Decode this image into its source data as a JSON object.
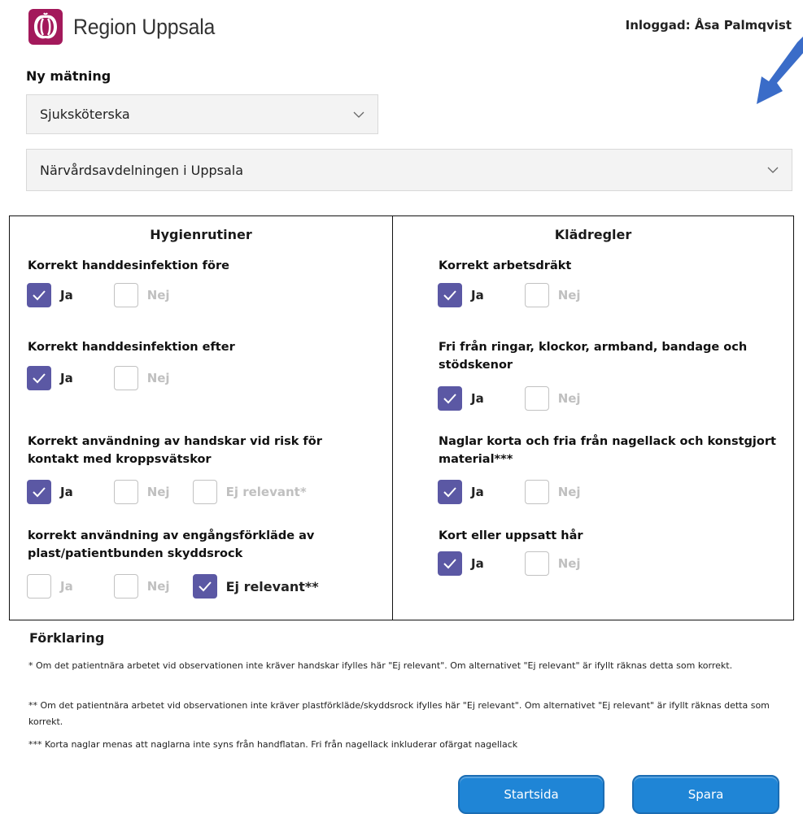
{
  "header": {
    "logo_text": "Region Uppsala",
    "user_label": "Inloggad: Åsa Palmqvist"
  },
  "form": {
    "title": "Ny mätning",
    "role_select": {
      "value": "Sjuksköterska"
    },
    "department_select": {
      "value": "Närvårdsavdelningen i Uppsala"
    }
  },
  "hygiene": {
    "title": "Hygienrutiner",
    "questions": [
      {
        "text": "Korrekt handdesinfektion före",
        "options": [
          {
            "label": "Ja",
            "checked": true
          },
          {
            "label": "Nej",
            "checked": false
          }
        ]
      },
      {
        "text": "Korrekt handdesinfektion efter",
        "options": [
          {
            "label": "Ja",
            "checked": true
          },
          {
            "label": "Nej",
            "checked": false
          }
        ]
      },
      {
        "text": "Korrekt användning av handskar vid risk för kontakt med kroppsvätskor",
        "options": [
          {
            "label": "Ja",
            "checked": true
          },
          {
            "label": "Nej",
            "checked": false
          },
          {
            "label": "Ej relevant*",
            "checked": false
          }
        ]
      },
      {
        "text": "korrekt användning av engångsförkläde av plast/patientbunden skyddsrock",
        "options": [
          {
            "label": "Ja",
            "checked": false
          },
          {
            "label": "Nej",
            "checked": false
          },
          {
            "label": "Ej relevant**",
            "checked": true
          }
        ]
      }
    ]
  },
  "clothing": {
    "title": "Klädregler",
    "questions": [
      {
        "text": "Korrekt arbetsdräkt",
        "options": [
          {
            "label": "Ja",
            "checked": true
          },
          {
            "label": "Nej",
            "checked": false
          }
        ]
      },
      {
        "text": "Fri från ringar, klockor, armband, bandage och stödskenor",
        "options": [
          {
            "label": "Ja",
            "checked": true
          },
          {
            "label": "Nej",
            "checked": false
          }
        ]
      },
      {
        "text": "Naglar korta och fria från nagellack och konstgjort material***",
        "options": [
          {
            "label": "Ja",
            "checked": true
          },
          {
            "label": "Nej",
            "checked": false
          }
        ]
      },
      {
        "text": "Kort eller uppsatt hår",
        "options": [
          {
            "label": "Ja",
            "checked": true
          },
          {
            "label": "Nej",
            "checked": false
          }
        ]
      }
    ]
  },
  "explanation": {
    "title": "Förklaring",
    "notes": [
      " * Om det patientnära arbetet vid observationen inte kräver handskar ifylles här \"Ej relevant\". Om alternativet \"Ej relevant\" är ifyllt räknas detta som korrekt.",
      " ** Om det patientnära arbetet vid observationen inte kräver plastförkläde/skyddsrock ifylles här \"Ej relevant\". Om alternativet \"Ej relevant\" är ifyllt räknas detta som korrekt.",
      "*** Korta naglar menas att naglarna inte syns från handflatan. Fri från nagellack inkluderar ofärgat nagellack"
    ]
  },
  "buttons": {
    "start": "Startsida",
    "save": "Spara"
  },
  "colors": {
    "checkbox_checked": "#5b58a4",
    "button_blue": "#1f85d6",
    "logo_magenta": "#a3195b",
    "arrow_blue": "#3a6cc8"
  }
}
